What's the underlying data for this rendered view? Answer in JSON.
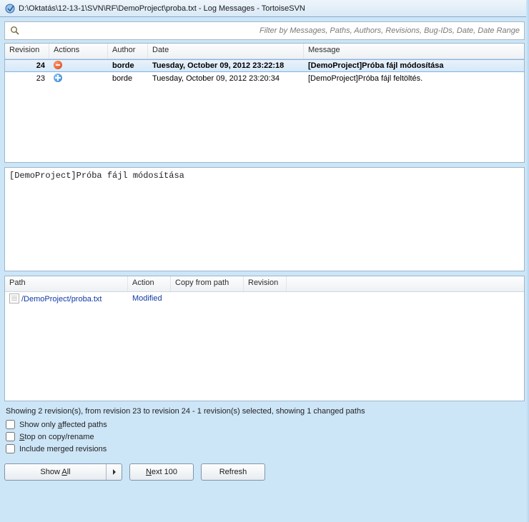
{
  "window": {
    "title": "D:\\Oktatás\\12-13-1\\SVN\\RF\\DemoProject\\proba.txt - Log Messages - TortoiseSVN"
  },
  "filter": {
    "placeholder": "Filter by Messages, Paths, Authors, Revisions, Bug-IDs, Date, Date Range"
  },
  "revisions": {
    "headers": {
      "revision": "Revision",
      "actions": "Actions",
      "author": "Author",
      "date": "Date",
      "message": "Message"
    },
    "rows": [
      {
        "revision": "24",
        "action_icon": "mod",
        "author": "borde",
        "date": "Tuesday, October 09, 2012 23:22:18",
        "message": "[DemoProject]Próba fájl módosítása",
        "selected": true
      },
      {
        "revision": "23",
        "action_icon": "add",
        "author": "borde",
        "date": "Tuesday, October 09, 2012 23:20:34",
        "message": "[DemoProject]Próba fájl feltöltés.",
        "selected": false
      }
    ]
  },
  "commit_message": "[DemoProject]Próba fájl módosítása",
  "paths": {
    "headers": {
      "path": "Path",
      "action": "Action",
      "copy": "Copy from path",
      "revision": "Revision"
    },
    "rows": [
      {
        "path": "/DemoProject/proba.txt",
        "action": "Modified",
        "copy": "",
        "revision": ""
      }
    ]
  },
  "status": "Showing 2 revision(s), from revision 23 to revision 24 - 1 revision(s) selected, showing 1 changed paths",
  "options": {
    "affected": "Show only affected paths",
    "stop": "Stop on copy/rename",
    "merged": "Include merged revisions"
  },
  "buttons": {
    "show_all": "Show All",
    "next_100": "Next 100",
    "refresh": "Refresh"
  }
}
